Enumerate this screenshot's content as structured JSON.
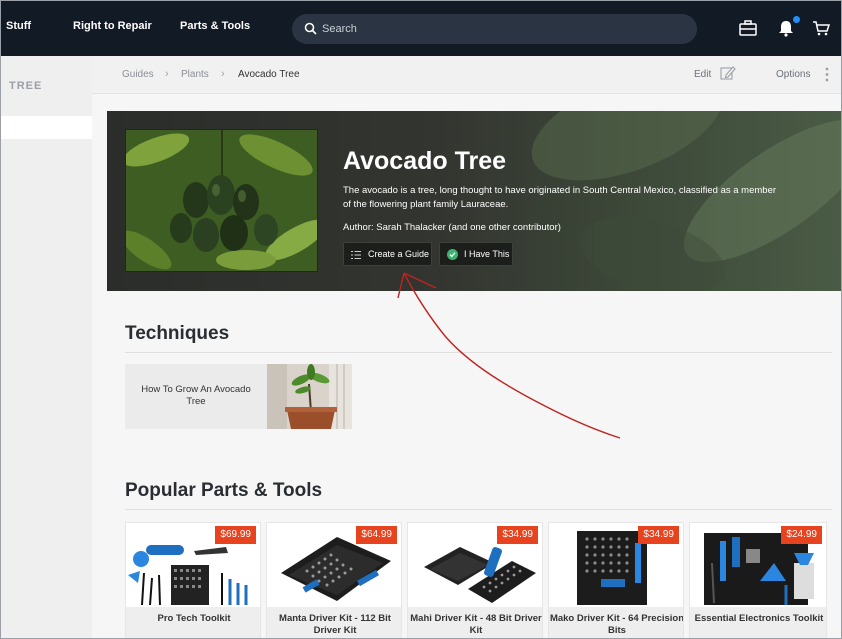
{
  "nav": {
    "items": [
      "Stuff",
      "Right to Repair",
      "Parts & Tools"
    ],
    "search_placeholder": "Search"
  },
  "sidebar": {
    "label": "TREE"
  },
  "breadcrumb": {
    "items": [
      "Guides",
      "Plants",
      "Avocado Tree"
    ],
    "edit_label": "Edit",
    "options_label": "Options"
  },
  "hero": {
    "title": "Avocado Tree",
    "description": "The avocado is a tree, long thought to have originated in South Central Mexico, classified as a member of the flowering plant family Lauraceae.",
    "author": "Author: Sarah Thalacker (and one other contributor)",
    "create_guide_label": "Create a Guide",
    "i_have_this_label": "I Have This"
  },
  "techniques": {
    "title": "Techniques",
    "items": [
      {
        "label": "How To Grow An Avocado Tree"
      }
    ]
  },
  "parts": {
    "title": "Popular Parts & Tools",
    "items": [
      {
        "name": "Pro Tech Toolkit",
        "price": "$69.99"
      },
      {
        "name": "Manta Driver Kit - 112 Bit Driver Kit",
        "price": "$64.99"
      },
      {
        "name": "Mahi Driver Kit - 48 Bit Driver Kit",
        "price": "$34.99"
      },
      {
        "name": "Mako Driver Kit - 64 Precision Bits",
        "price": "$34.99"
      },
      {
        "name": "Essential Electronics Toolkit",
        "price": "$24.99"
      }
    ]
  },
  "colors": {
    "nav_bg": "#121a26",
    "price_badge": "#e8431f",
    "annotation": "#c0231f",
    "notification_dot": "#1e90ff",
    "have_this_check": "#3cb371"
  }
}
